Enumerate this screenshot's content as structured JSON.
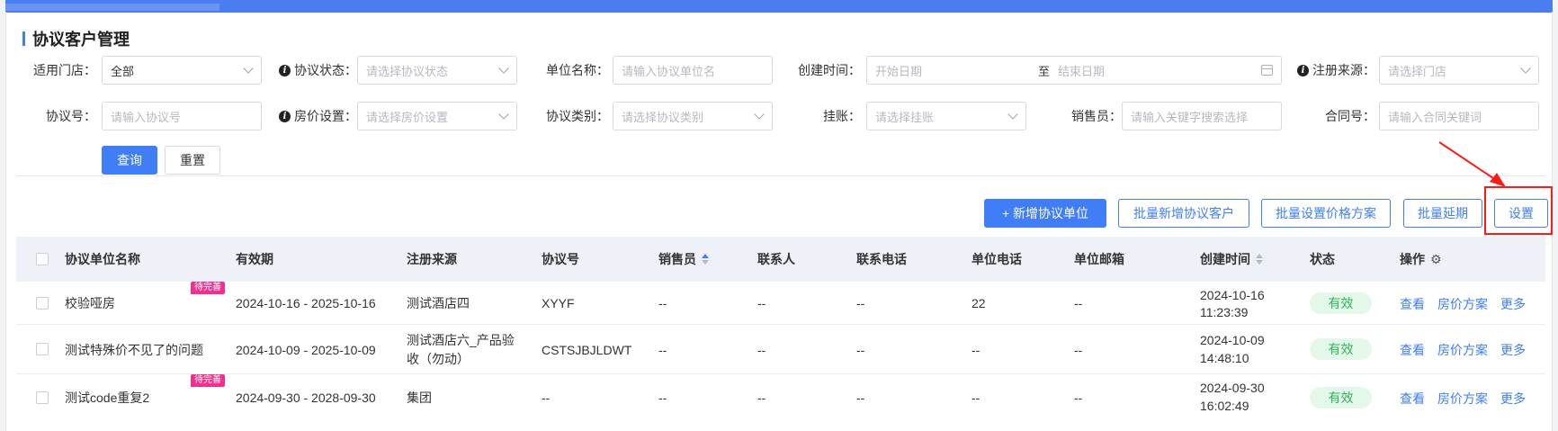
{
  "page": {
    "title": "协议客户管理"
  },
  "filters": {
    "store": {
      "label": "适用门店：",
      "value": "全部"
    },
    "protocol_status": {
      "label": "协议状态：",
      "placeholder": "请选择协议状态"
    },
    "unit_name": {
      "label": "单位名称：",
      "placeholder": "请输入协议单位名"
    },
    "create_time": {
      "label": "创建时间：",
      "start_placeholder": "开始日期",
      "sep": "至",
      "end_placeholder": "结束日期"
    },
    "register_source": {
      "label": "注册来源：",
      "placeholder": "请选择门店"
    },
    "protocol_no": {
      "label": "协议号：",
      "placeholder": "请输入协议号"
    },
    "room_price": {
      "label": "房价设置：",
      "placeholder": "请选择房价设置"
    },
    "protocol_type": {
      "label": "协议类别：",
      "placeholder": "请选择协议类别"
    },
    "credit": {
      "label": "挂账：",
      "placeholder": "请选择挂账"
    },
    "salesperson": {
      "label": "销售员：",
      "placeholder": "请输入关键字搜索选择"
    },
    "contract_no": {
      "label": "合同号：",
      "placeholder": "请输入合同关键词"
    },
    "query_label": "查询",
    "reset_label": "重置"
  },
  "toolbar": {
    "add_label": "+ 新增协议单位",
    "batch_add_label": "批量新增协议客户",
    "batch_price_label": "批量设置价格方案",
    "batch_extend_label": "批量延期",
    "settings_label": "设置"
  },
  "table": {
    "headers": {
      "name": "协议单位名称",
      "validity": "有效期",
      "source": "注册来源",
      "protocol_no": "协议号",
      "salesperson": "销售员",
      "contact": "联系人",
      "contact_phone": "联系电话",
      "unit_phone": "单位电话",
      "unit_email": "单位邮箱",
      "created": "创建时间",
      "status": "状态",
      "ops": "操作"
    },
    "rows": [
      {
        "name": "校验哑房",
        "tag": "待完善",
        "validity": "2024-10-16 - 2025-10-16",
        "source": "测试酒店四",
        "protocol_no": "XYYF",
        "salesperson": "--",
        "contact": "--",
        "contact_phone": "--",
        "unit_phone": "22",
        "unit_email": "--",
        "created_date": "2024-10-16",
        "created_time": "11:23:39",
        "status": "有效",
        "view": "查看",
        "price": "房价方案",
        "more": "更多"
      },
      {
        "name": "测试特殊价不见了的问题",
        "tag": "",
        "validity": "2024-10-09 - 2025-10-09",
        "source_line1": "测试酒店六_产品验",
        "source_line2": "收（勿动）",
        "protocol_no": "CSTSJBJLDWT",
        "salesperson": "--",
        "contact": "--",
        "contact_phone": "--",
        "unit_phone": "--",
        "unit_email": "--",
        "created_date": "2024-10-09",
        "created_time": "14:48:10",
        "status": "有效",
        "view": "查看",
        "price": "房价方案",
        "more": "更多"
      },
      {
        "name": "测试code重复2",
        "tag": "待完善",
        "validity": "2024-09-30 - 2028-09-30",
        "source": "集团",
        "protocol_no": "--",
        "salesperson": "--",
        "contact": "--",
        "contact_phone": "--",
        "unit_phone": "--",
        "unit_email": "--",
        "created_date": "2024-09-30",
        "created_time": "16:02:49",
        "status": "有效",
        "view": "查看",
        "price": "房价方案",
        "more": "更多"
      }
    ]
  },
  "colors": {
    "primary": "#3f7ef7",
    "status_green": "#2db556",
    "tag_pink": "#f0308e",
    "highlight_red": "#ff1a1a"
  }
}
